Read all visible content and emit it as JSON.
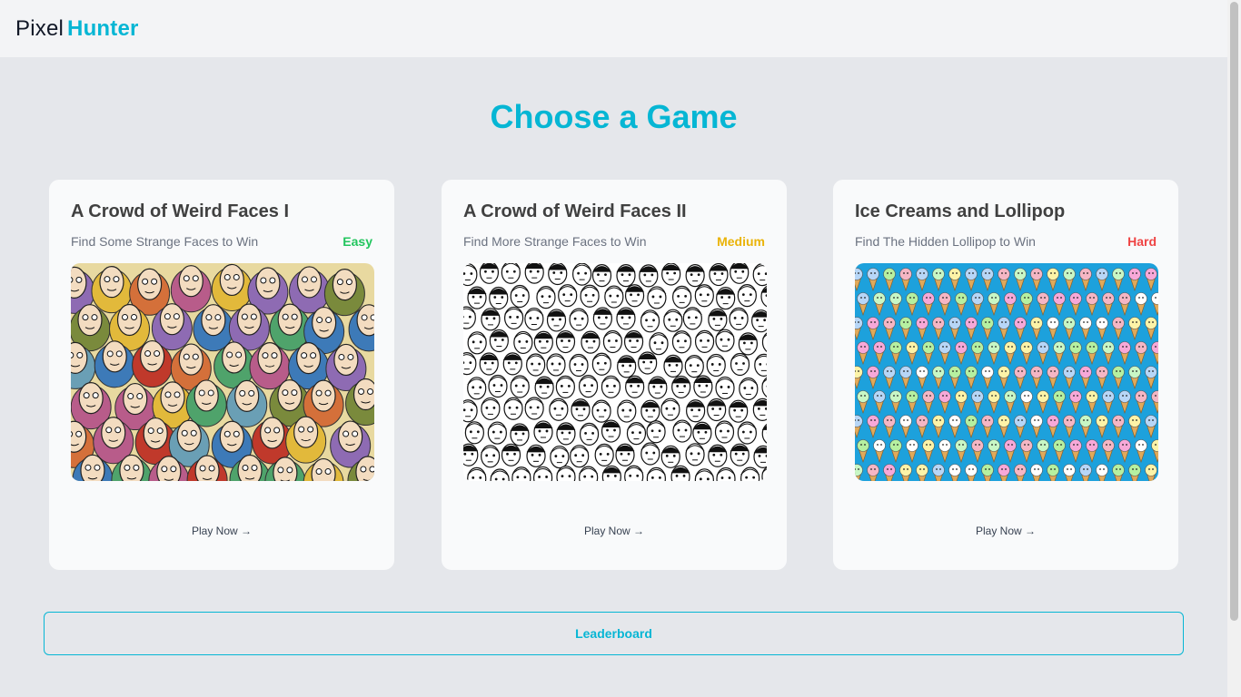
{
  "header": {
    "logo_plain": "Pixel",
    "logo_accent": "Hunter"
  },
  "page_title": "Choose a Game",
  "colors": {
    "accent": "#06b6d4",
    "easy": "#22c55e",
    "medium": "#eab308",
    "hard": "#ef4444"
  },
  "games": [
    {
      "title": "A Crowd of Weird Faces I",
      "subtitle": "Find Some Strange Faces to Win",
      "difficulty": "Easy",
      "play_label": "Play Now →",
      "image": "colorful-crowd-image"
    },
    {
      "title": "A Crowd of Weird Faces II",
      "subtitle": "Find More Strange Faces to Win",
      "difficulty": "Medium",
      "play_label": "Play Now →",
      "image": "black-white-crowd-image"
    },
    {
      "title": "Ice Creams and Lollipop",
      "subtitle": "Find The Hidden Lollipop to Win",
      "difficulty": "Hard",
      "play_label": "Play Now →",
      "image": "ice-cream-pattern-image"
    }
  ],
  "leaderboard_label": "Leaderboard"
}
